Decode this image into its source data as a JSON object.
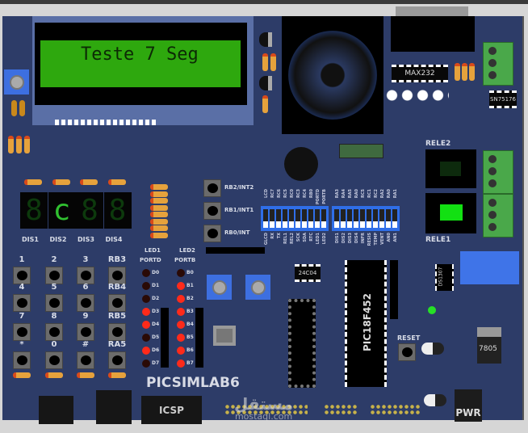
{
  "lcd": {
    "text": "Teste 7 Seg"
  },
  "displays": [
    {
      "label": "DIS1",
      "glyph": "8",
      "on": false
    },
    {
      "label": "DIS2",
      "glyph": "c",
      "on": true
    },
    {
      "label": "DIS3",
      "glyph": "8",
      "on": false
    },
    {
      "label": "DIS4",
      "glyph": "8",
      "on": false
    }
  ],
  "keypad": {
    "labels": [
      "1",
      "2",
      "3",
      "RB3",
      "4",
      "5",
      "6",
      "RB4",
      "7",
      "8",
      "9",
      "RB5",
      "*",
      "0",
      "#",
      "RA5"
    ]
  },
  "led_banks": [
    {
      "title": "LED1",
      "port": "PORTD",
      "leds": [
        {
          "label": "D0",
          "on": false
        },
        {
          "label": "D1",
          "on": false
        },
        {
          "label": "D2",
          "on": false
        },
        {
          "label": "D3",
          "on": true
        },
        {
          "label": "D4",
          "on": true
        },
        {
          "label": "D5",
          "on": false
        },
        {
          "label": "D6",
          "on": true
        },
        {
          "label": "D7",
          "on": false
        }
      ]
    },
    {
      "title": "LED2",
      "port": "PORTB",
      "leds": [
        {
          "label": "B0",
          "on": false
        },
        {
          "label": "B1",
          "on": true
        },
        {
          "label": "B2",
          "on": true
        },
        {
          "label": "B3",
          "on": true
        },
        {
          "label": "B4",
          "on": true
        },
        {
          "label": "B5",
          "on": true
        },
        {
          "label": "B6",
          "on": true
        },
        {
          "label": "B7",
          "on": true
        }
      ]
    }
  ],
  "int_buttons": [
    "RB2/INT2",
    "RB1/INT1",
    "RB0/INT"
  ],
  "dip_left": {
    "top": [
      "LCD",
      "RC7",
      "RC6",
      "RC5",
      "RC0",
      "RC3",
      "RC4",
      "RB0",
      "PORTD",
      "PORTB"
    ],
    "bottom": [
      "GLCD",
      "RX",
      "TX",
      "REL1",
      "REL2",
      "SCK",
      "SDA",
      "RTC",
      "LED1",
      "LED2"
    ]
  },
  "dip_right": {
    "top": [
      "RA3",
      "RA4",
      "RA5",
      "RA0",
      "RC5",
      "RC1",
      "RC2",
      "RA2",
      "RA0",
      "RA1"
    ],
    "bottom": [
      "DIS1",
      "DIS2",
      "DIS3",
      "DIS4",
      "INFR",
      "RESIS",
      "TEMP",
      "VENT",
      "AN0",
      "AN1"
    ]
  },
  "chips": {
    "max232": "MAX232",
    "sn75176": "SN75176",
    "eeprom": "24C04",
    "mcu": "PIC18F452",
    "rtc": "DS1307",
    "regulator": "7805"
  },
  "relays": {
    "rele1": "RELE1",
    "rele2": "RELE2",
    "rele1_on": true,
    "rele2_on": false
  },
  "labels": {
    "brand": "PICSIMLAB6",
    "icsp": "ICSP",
    "reset": "RESET",
    "pwr": "PWR"
  },
  "watermark": {
    "arabic": "مستقل",
    "latin": "mostaql.com"
  },
  "colors": {
    "board": "#2d3c68",
    "led_on": "#ff2a1a",
    "led_off": "#2a0a06",
    "lcd": "#2ea80e"
  }
}
